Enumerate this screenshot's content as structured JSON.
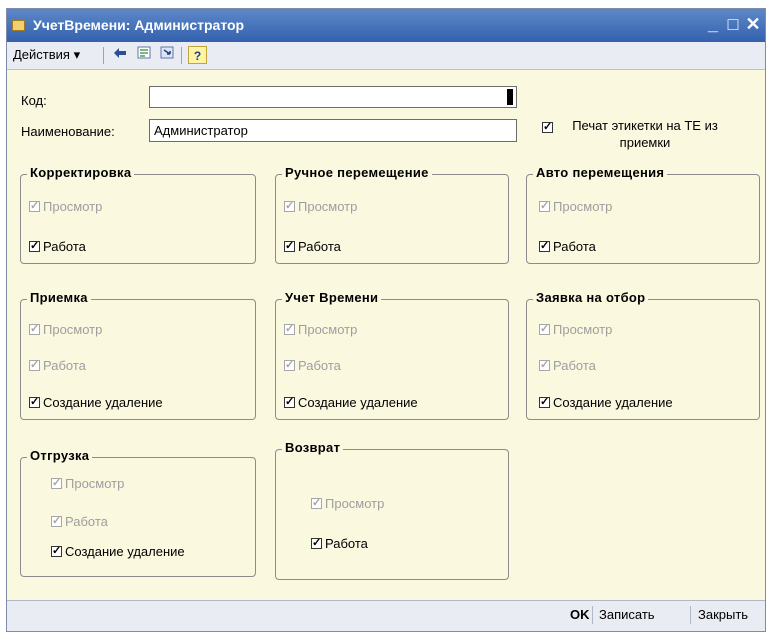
{
  "window": {
    "title": "УчетВремени: Администратор",
    "icon": "app-icon"
  },
  "titlebar_buttons": {
    "minimize": "_",
    "maximize": "□",
    "close": "✕"
  },
  "toolbar": {
    "actions_label": "Действия ▾",
    "help_label": "?"
  },
  "form": {
    "code_label": "Код:",
    "code_value": "",
    "name_label": "Наименование:",
    "name_value": "Администратор",
    "print_labels_checkbox": {
      "label": "Печат этикетки на ТЕ из приемки",
      "checked": true
    }
  },
  "groups": {
    "correction": {
      "title": "Корректировка",
      "view": "Просмотр",
      "work": "Работа"
    },
    "manual_move": {
      "title": "Ручное перемещение",
      "view": "Просмотр",
      "work": "Работа"
    },
    "auto_move": {
      "title": "Авто перемещения",
      "view": "Просмотр",
      "work": "Работа"
    },
    "receiving": {
      "title": "Приемка",
      "view": "Просмотр",
      "work": "Работа",
      "create": "Создание удаление"
    },
    "time_tracking": {
      "title": "Учет Времени",
      "view": "Просмотр",
      "work": "Работа",
      "create": "Создание удаление"
    },
    "pick_request": {
      "title": "Заявка на отбор",
      "view": "Просмотр",
      "work": "Работа",
      "create": "Создание удаление"
    },
    "shipment": {
      "title": "Отгрузка",
      "view": "Просмотр",
      "work": "Работа",
      "create": "Создание удаление"
    },
    "return": {
      "title": "Возврат",
      "view": "Просмотр",
      "work": "Работа"
    }
  },
  "bottom": {
    "ok": "OK",
    "save": "Записать",
    "close": "Закрыть"
  },
  "colors": {
    "form_bg": "#fbf8e0",
    "titlebar": "#3a67b2",
    "disabled_text": "#9e9e9e"
  }
}
